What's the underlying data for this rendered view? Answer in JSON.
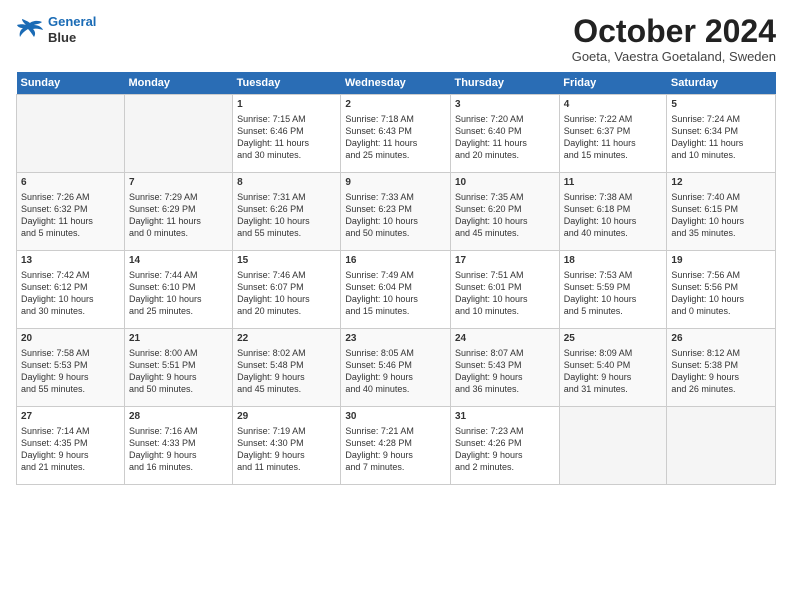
{
  "header": {
    "logo_line1": "General",
    "logo_line2": "Blue",
    "title": "October 2024",
    "subtitle": "Goeta, Vaestra Goetaland, Sweden"
  },
  "columns": [
    "Sunday",
    "Monday",
    "Tuesday",
    "Wednesday",
    "Thursday",
    "Friday",
    "Saturday"
  ],
  "weeks": [
    [
      {
        "day": "",
        "info": ""
      },
      {
        "day": "",
        "info": ""
      },
      {
        "day": "1",
        "info": "Sunrise: 7:15 AM\nSunset: 6:46 PM\nDaylight: 11 hours\nand 30 minutes."
      },
      {
        "day": "2",
        "info": "Sunrise: 7:18 AM\nSunset: 6:43 PM\nDaylight: 11 hours\nand 25 minutes."
      },
      {
        "day": "3",
        "info": "Sunrise: 7:20 AM\nSunset: 6:40 PM\nDaylight: 11 hours\nand 20 minutes."
      },
      {
        "day": "4",
        "info": "Sunrise: 7:22 AM\nSunset: 6:37 PM\nDaylight: 11 hours\nand 15 minutes."
      },
      {
        "day": "5",
        "info": "Sunrise: 7:24 AM\nSunset: 6:34 PM\nDaylight: 11 hours\nand 10 minutes."
      }
    ],
    [
      {
        "day": "6",
        "info": "Sunrise: 7:26 AM\nSunset: 6:32 PM\nDaylight: 11 hours\nand 5 minutes."
      },
      {
        "day": "7",
        "info": "Sunrise: 7:29 AM\nSunset: 6:29 PM\nDaylight: 11 hours\nand 0 minutes."
      },
      {
        "day": "8",
        "info": "Sunrise: 7:31 AM\nSunset: 6:26 PM\nDaylight: 10 hours\nand 55 minutes."
      },
      {
        "day": "9",
        "info": "Sunrise: 7:33 AM\nSunset: 6:23 PM\nDaylight: 10 hours\nand 50 minutes."
      },
      {
        "day": "10",
        "info": "Sunrise: 7:35 AM\nSunset: 6:20 PM\nDaylight: 10 hours\nand 45 minutes."
      },
      {
        "day": "11",
        "info": "Sunrise: 7:38 AM\nSunset: 6:18 PM\nDaylight: 10 hours\nand 40 minutes."
      },
      {
        "day": "12",
        "info": "Sunrise: 7:40 AM\nSunset: 6:15 PM\nDaylight: 10 hours\nand 35 minutes."
      }
    ],
    [
      {
        "day": "13",
        "info": "Sunrise: 7:42 AM\nSunset: 6:12 PM\nDaylight: 10 hours\nand 30 minutes."
      },
      {
        "day": "14",
        "info": "Sunrise: 7:44 AM\nSunset: 6:10 PM\nDaylight: 10 hours\nand 25 minutes."
      },
      {
        "day": "15",
        "info": "Sunrise: 7:46 AM\nSunset: 6:07 PM\nDaylight: 10 hours\nand 20 minutes."
      },
      {
        "day": "16",
        "info": "Sunrise: 7:49 AM\nSunset: 6:04 PM\nDaylight: 10 hours\nand 15 minutes."
      },
      {
        "day": "17",
        "info": "Sunrise: 7:51 AM\nSunset: 6:01 PM\nDaylight: 10 hours\nand 10 minutes."
      },
      {
        "day": "18",
        "info": "Sunrise: 7:53 AM\nSunset: 5:59 PM\nDaylight: 10 hours\nand 5 minutes."
      },
      {
        "day": "19",
        "info": "Sunrise: 7:56 AM\nSunset: 5:56 PM\nDaylight: 10 hours\nand 0 minutes."
      }
    ],
    [
      {
        "day": "20",
        "info": "Sunrise: 7:58 AM\nSunset: 5:53 PM\nDaylight: 9 hours\nand 55 minutes."
      },
      {
        "day": "21",
        "info": "Sunrise: 8:00 AM\nSunset: 5:51 PM\nDaylight: 9 hours\nand 50 minutes."
      },
      {
        "day": "22",
        "info": "Sunrise: 8:02 AM\nSunset: 5:48 PM\nDaylight: 9 hours\nand 45 minutes."
      },
      {
        "day": "23",
        "info": "Sunrise: 8:05 AM\nSunset: 5:46 PM\nDaylight: 9 hours\nand 40 minutes."
      },
      {
        "day": "24",
        "info": "Sunrise: 8:07 AM\nSunset: 5:43 PM\nDaylight: 9 hours\nand 36 minutes."
      },
      {
        "day": "25",
        "info": "Sunrise: 8:09 AM\nSunset: 5:40 PM\nDaylight: 9 hours\nand 31 minutes."
      },
      {
        "day": "26",
        "info": "Sunrise: 8:12 AM\nSunset: 5:38 PM\nDaylight: 9 hours\nand 26 minutes."
      }
    ],
    [
      {
        "day": "27",
        "info": "Sunrise: 7:14 AM\nSunset: 4:35 PM\nDaylight: 9 hours\nand 21 minutes."
      },
      {
        "day": "28",
        "info": "Sunrise: 7:16 AM\nSunset: 4:33 PM\nDaylight: 9 hours\nand 16 minutes."
      },
      {
        "day": "29",
        "info": "Sunrise: 7:19 AM\nSunset: 4:30 PM\nDaylight: 9 hours\nand 11 minutes."
      },
      {
        "day": "30",
        "info": "Sunrise: 7:21 AM\nSunset: 4:28 PM\nDaylight: 9 hours\nand 7 minutes."
      },
      {
        "day": "31",
        "info": "Sunrise: 7:23 AM\nSunset: 4:26 PM\nDaylight: 9 hours\nand 2 minutes."
      },
      {
        "day": "",
        "info": ""
      },
      {
        "day": "",
        "info": ""
      }
    ]
  ]
}
